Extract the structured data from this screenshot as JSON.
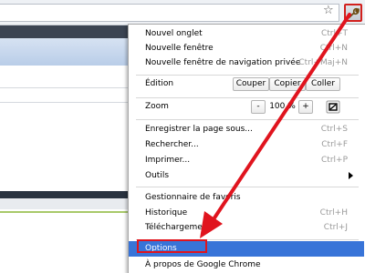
{
  "toolbar": {
    "star_icon": "star-icon",
    "wrench_icon": "wrench-icon",
    "accent": "#d2201d"
  },
  "menu": {
    "new_tab": {
      "label": "Nouvel onglet",
      "shortcut": "Ctrl+T"
    },
    "new_window": {
      "label": "Nouvelle fenêtre",
      "shortcut": "Ctrl+N"
    },
    "new_incognito": {
      "label": "Nouvelle fenêtre de navigation privée",
      "shortcut": "Ctrl+Maj+N"
    },
    "edit": {
      "label": "Édition",
      "cut": "Couper",
      "copy": "Copier",
      "paste": "Coller"
    },
    "zoom": {
      "label": "Zoom",
      "minus": "-",
      "value": "100 %",
      "plus": "+"
    },
    "save_page": {
      "label": "Enregistrer la page sous...",
      "shortcut": "Ctrl+S"
    },
    "find": {
      "label": "Rechercher...",
      "shortcut": "Ctrl+F"
    },
    "print": {
      "label": "Imprimer...",
      "shortcut": "Ctrl+P"
    },
    "tools": {
      "label": "Outils"
    },
    "bookmark_manager": {
      "label": "Gestionnaire de favoris"
    },
    "history": {
      "label": "Historique",
      "shortcut": "Ctrl+H"
    },
    "downloads": {
      "label": "Téléchargements",
      "shortcut": "Ctrl+J"
    },
    "options": {
      "label": "Options"
    },
    "about": {
      "label": "À propos de Google Chrome"
    },
    "highlight_color": "#3874d8"
  },
  "annotation": {
    "color": "#e0141e"
  }
}
